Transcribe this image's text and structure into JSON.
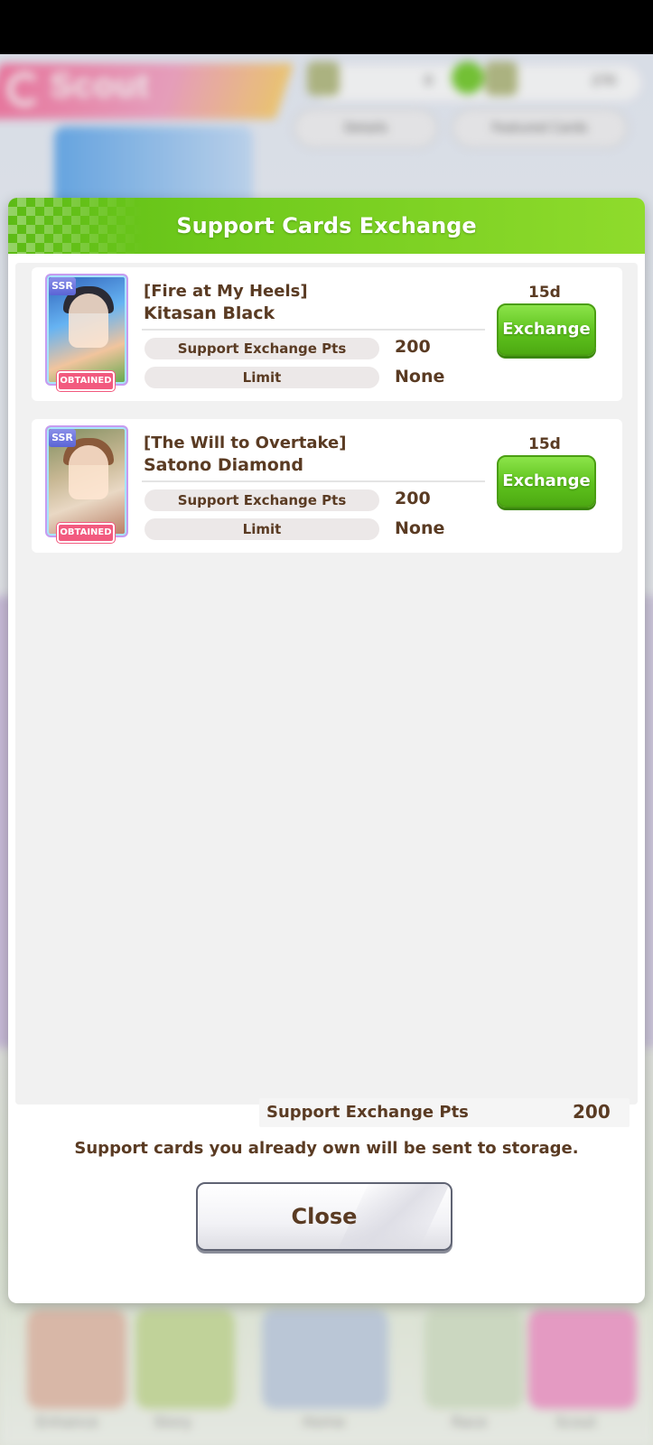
{
  "background": {
    "scout_title": "Scout",
    "details_label": "Details",
    "featured_label": "Featured Cards",
    "currency_count_1": "0",
    "currency_count_2": "270",
    "nav": [
      "Enhance",
      "Story",
      "Home",
      "Race",
      "Scout"
    ]
  },
  "dialog": {
    "title": "Support Cards Exchange",
    "cards": [
      {
        "rarity": "SSR",
        "title_line": "[Fire at My Heels]",
        "name": "Kitasan Black",
        "status_badge": "OBTAINED",
        "pts_label": "Support Exchange Pts",
        "pts_value": "200",
        "limit_label": "Limit",
        "limit_value": "None",
        "days_left": "15d",
        "button_label": "Exchange"
      },
      {
        "rarity": "SSR",
        "title_line": "[The Will to Overtake]",
        "name": "Satono Diamond",
        "status_badge": "OBTAINED",
        "pts_label": "Support Exchange Pts",
        "pts_value": "200",
        "limit_label": "Limit",
        "limit_value": "None",
        "days_left": "15d",
        "button_label": "Exchange"
      }
    ],
    "footer": {
      "pts_label": "Support Exchange Pts",
      "pts_value": "200",
      "notice": "Support cards you already own will be sent to storage.",
      "close_label": "Close"
    }
  },
  "colors": {
    "header_green": "#6ec91c",
    "button_green": "#5ec21d",
    "text_brown": "#5a3b23",
    "badge_pink": "#f25a7f"
  },
  "icons": [
    "scout-icon",
    "currency-add-icon",
    "ssr-badge"
  ]
}
